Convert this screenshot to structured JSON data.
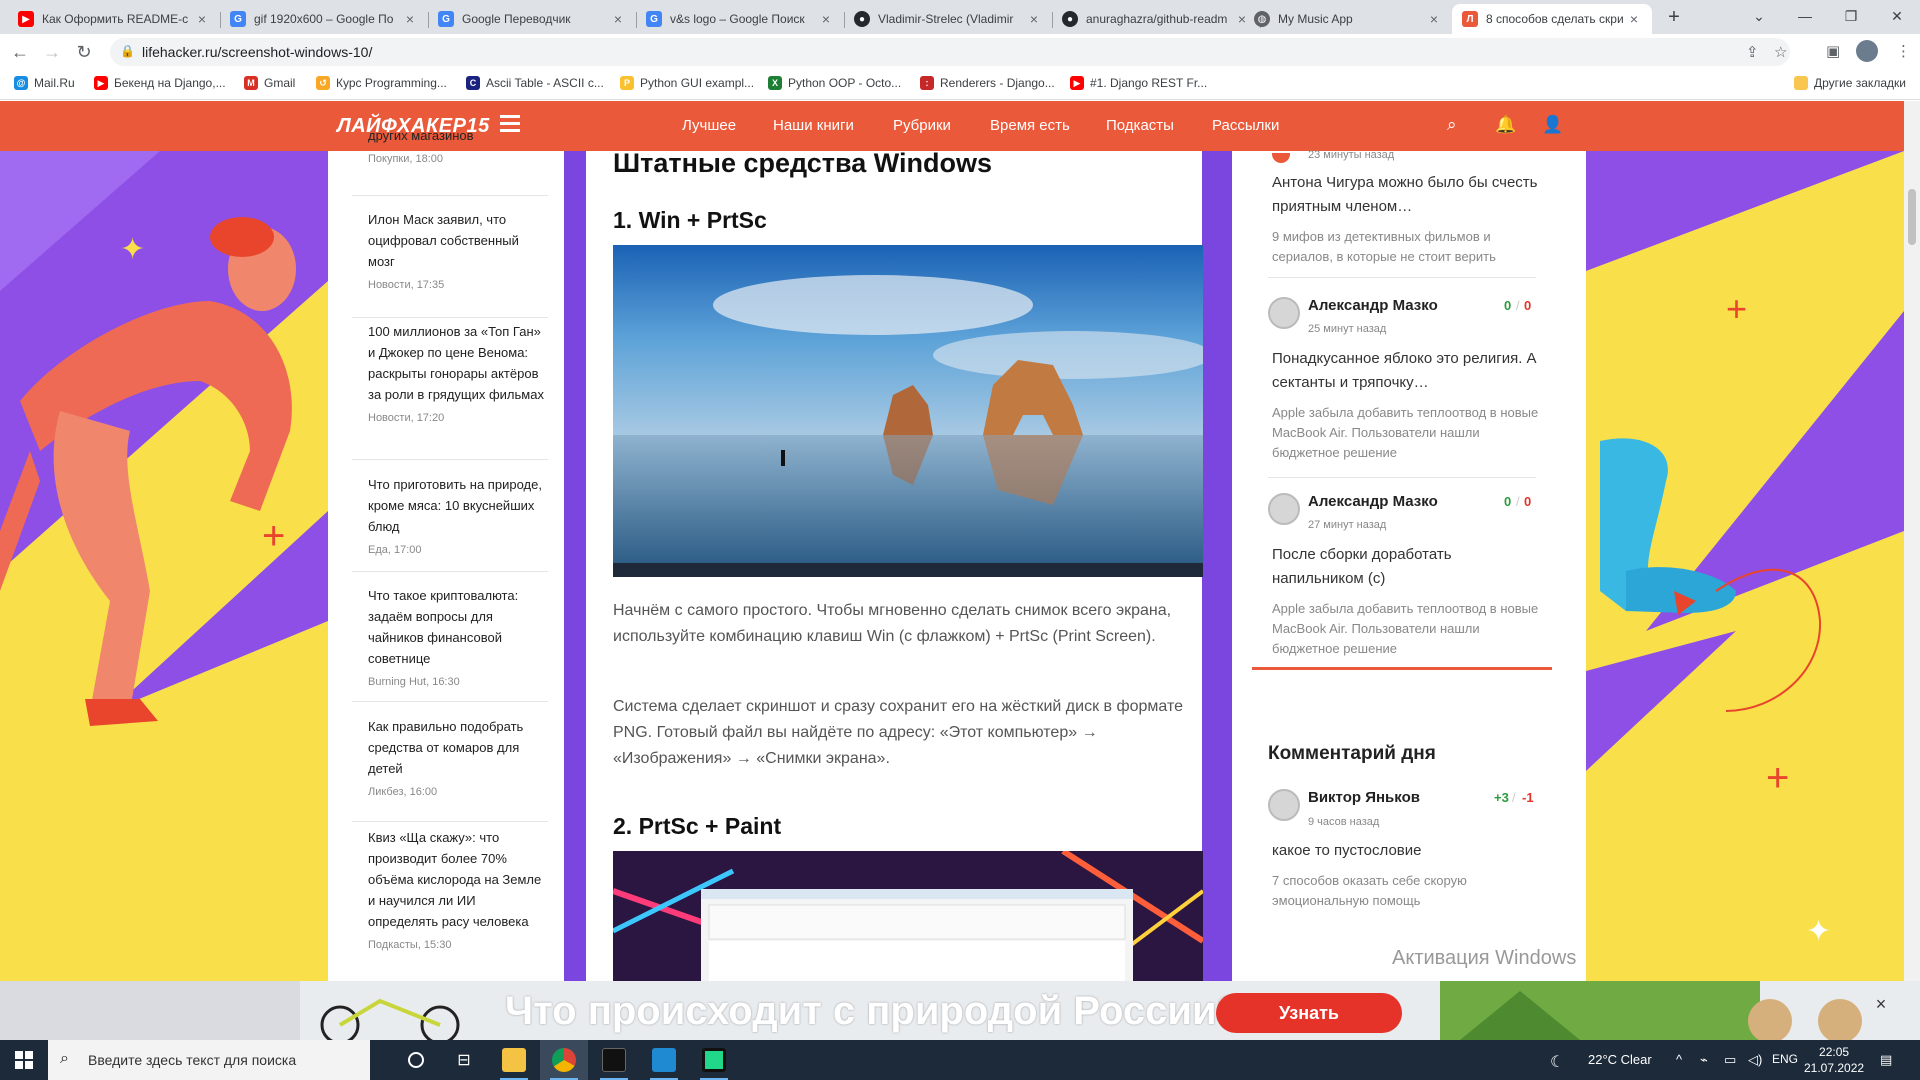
{
  "browser": {
    "tabs": [
      {
        "title": "Как Оформить README-с",
        "icon": "youtube-icon",
        "color": "#ff0000"
      },
      {
        "title": "gif 1920x600 – Google По",
        "icon": "google-icon",
        "color": "#4285f4"
      },
      {
        "title": "Google Переводчик",
        "icon": "translate-icon",
        "color": "#4285f4"
      },
      {
        "title": "v&s logo – Google Поиск",
        "icon": "google-icon",
        "color": "#4285f4"
      },
      {
        "title": "Vladimir-Strelec (Vladimir",
        "icon": "github-icon",
        "color": "#24292f"
      },
      {
        "title": "anuraghazra/github-readm",
        "icon": "github-icon",
        "color": "#24292f"
      },
      {
        "title": "My Music App",
        "icon": "globe-icon",
        "color": "#5f6368"
      },
      {
        "title": "8 способов сделать скри",
        "icon": "lifehacker-icon",
        "color": "#ea5a3a"
      }
    ],
    "url": "lifehacker.ru/screenshot-windows-10/",
    "bookmarks": [
      {
        "label": "Mail.Ru",
        "color": "#168de2"
      },
      {
        "label": "Бекенд на Django,...",
        "color": "#ff0000"
      },
      {
        "label": "Gmail",
        "color": "#d93025"
      },
      {
        "label": "Курс Programming...",
        "color": "#f9a825"
      },
      {
        "label": "Ascii Table - ASCII c...",
        "color": "#1a237e"
      },
      {
        "label": "Python GUI exampl...",
        "color": "#fbc02d"
      },
      {
        "label": "Python OOP - Octo...",
        "color": "#1e7e34"
      },
      {
        "label": "Renderers - Django...",
        "color": "#c62828"
      },
      {
        "label": "#1. Django REST Fr...",
        "color": "#ff0000"
      }
    ],
    "other_bookmarks": "Другие закладки"
  },
  "site": {
    "logo": "ЛАЙФХАКЕР15",
    "nav": [
      "Лучшее",
      "Наши книги",
      "Рубрики",
      "Время есть",
      "Подкасты",
      "Рассылки"
    ]
  },
  "left_news": [
    {
      "title": "других магазинов",
      "meta": "Покупки, 18:00"
    },
    {
      "title": "Илон Маск заявил, что оцифровал собственный мозг",
      "meta": "Новости, 17:35"
    },
    {
      "title": "100 миллионов за «Топ Ган» и Джокер по цене Венома: раскрыты гонорары актёров за роли в грядущих фильмах",
      "meta": "Новости, 17:20"
    },
    {
      "title": "Что приготовить на природе, кроме мяса: 10 вкуснейших блюд",
      "meta": "Еда, 17:00"
    },
    {
      "title": "Что такое криптовалюта: задаём вопросы для чайников финансовой советнице",
      "meta": "Burning Hut, 16:30"
    },
    {
      "title": "Как правильно подобрать средства от комаров для детей",
      "meta": "Ликбез, 16:00"
    },
    {
      "title": "Квиз «Ща скажу»: что производит более 70% объёма кислорода на Земле и научился ли ИИ определять расу человека",
      "meta": "Подкасты, 15:30"
    }
  ],
  "article": {
    "section_title": "Штатные средства Windows",
    "step1_title": "1. Win + PrtSc",
    "para1": "Начнём с самого простого. Чтобы мгновенно сделать снимок всего экрана, используйте комбинацию клавиш Win (с флажком) + PrtSc (Print Screen).",
    "para2": "Система сделает скриншот и сразу сохранит его на жёсткий диск в формате PNG. Готовый файл вы найдёте по адресу: «Этот компьютер» → «Изображения» → «Снимки экрана».",
    "step2_title": "2. PrtSc + Paint"
  },
  "comments": [
    {
      "time": "23 минуты назад",
      "text": "Антона Чигура можно было бы счесть приятным членом…",
      "article": "9 мифов из детективных фильмов и сериалов, в которые не стоит верить"
    },
    {
      "name": "Александр Мазко",
      "time": "25 минут назад",
      "up": "0",
      "down": "0",
      "text": "Понадкусанное яблоко это религия. А сектанты и тряпочку…",
      "article": "Apple забыла добавить теплоотвод в новые MacBook Air. Пользователи нашли бюджетное решение"
    },
    {
      "name": "Александр Мазко",
      "time": "27 минут назад",
      "up": "0",
      "down": "0",
      "text": "После сборки доработать напильником (с)",
      "article": "Apple забыла добавить теплоотвод в новые MacBook Air. Пользователи нашли бюджетное решение"
    }
  ],
  "comment_of_day": {
    "heading": "Комментарий дня",
    "name": "Виктор Яньков",
    "time": "9 часов назад",
    "up": "+3",
    "down": "-1",
    "text": "какое то пустословие",
    "article": "7 способов оказать себе скорую эмоциональную помощь"
  },
  "activation": "Активация Windows",
  "banner": {
    "text": "Что происходит с природой России?",
    "button": "Узнать"
  },
  "taskbar": {
    "search_placeholder": "Введите здесь текст для поиска",
    "weather": "22°C  Clear",
    "lang": "ENG",
    "time": "22:05",
    "date": "21.07.2022"
  }
}
